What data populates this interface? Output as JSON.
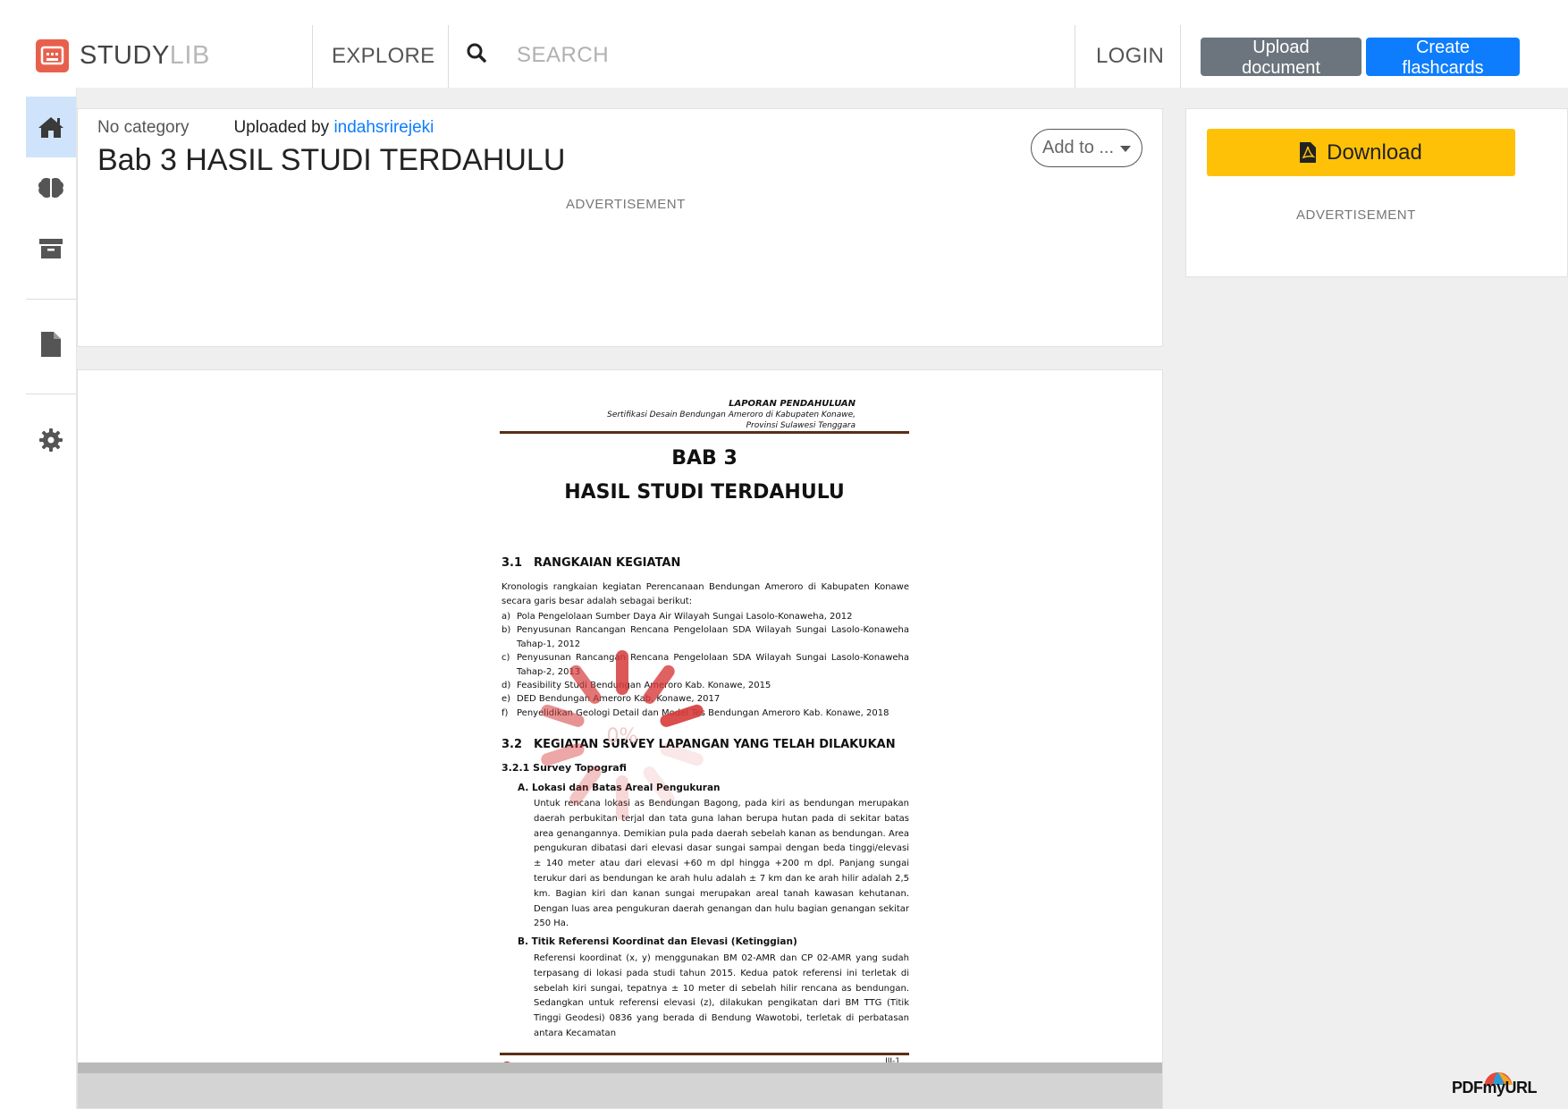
{
  "header": {
    "logo": {
      "prefix": "STUDY",
      "suffix": "LIB"
    },
    "explore_label": "EXPLORE",
    "search_placeholder": "SEARCH",
    "login_label": "LOGIN",
    "upload_label": "Upload document",
    "flashcards_label": "Create flashcards"
  },
  "sidebar": {
    "items": [
      {
        "icon": "home-icon",
        "active": true
      },
      {
        "icon": "brain-icon",
        "active": false
      },
      {
        "icon": "archive-icon",
        "active": false
      },
      {
        "icon": "document-icon",
        "active": false
      },
      {
        "icon": "gear-icon",
        "active": false
      }
    ]
  },
  "document": {
    "category": "No category",
    "uploaded_by_label": "Uploaded by",
    "uploader": "indahsrirejeki",
    "title": "Bab 3 HASIL STUDI TERDAHULU",
    "add_to_label": "Add to ...",
    "advertisement_label": "ADVERTISEMENT"
  },
  "right_panel": {
    "download_label": "Download",
    "advertisement_label": "ADVERTISEMENT"
  },
  "viewer": {
    "report_title": "LAPORAN PENDAHULUAN",
    "report_subtitle_1": "Sertifikasi Desain Bendungan Ameroro di Kabupaten Konawe,",
    "report_subtitle_2": "Provinsi Sulawesi Tenggara",
    "chapter": "BAB 3",
    "chapter_title": "HASIL STUDI TERDAHULU",
    "section_1": {
      "num": "3.1",
      "title": "RANGKAIAN KEGIATAN"
    },
    "intro": "Kronologis rangkaian kegiatan Perencanaan Bendungan Ameroro di Kabupaten Konawe secara garis besar adalah sebagai berikut:",
    "list": [
      {
        "letter": "a)",
        "text": "Pola Pengelolaan Sumber Daya Air Wilayah Sungai Lasolo-Konaweha, 2012"
      },
      {
        "letter": "b)",
        "text": "Penyusunan Rancangan Rencana Pengelolaan SDA Wilayah Sungai Lasolo-Konaweha Tahap-1, 2012"
      },
      {
        "letter": "c)",
        "text": "Penyusunan Rancangan Rencana Pengelolaan SDA Wilayah Sungai Lasolo-Konaweha Tahap-2, 2013"
      },
      {
        "letter": "d)",
        "text": "Feasibility Studi Bendungan Ameroro Kab. Konawe, 2015"
      },
      {
        "letter": "e)",
        "text": "DED Bendungan Ameroro Kab. Konawe, 2017"
      },
      {
        "letter": "f)",
        "text": "Penyelidikan Geologi Detail dan Model Tes Bendungan Ameroro Kab. Konawe, 2018"
      }
    ],
    "section_2": {
      "num": "3.2",
      "title": "KEGIATAN SURVEY LAPANGAN YANG TELAH DILAKUKAN"
    },
    "subsection": "3.2.1 Survey Topografi",
    "sub_a": "A. Lokasi dan Batas Areal Pengukuran",
    "para_a": "Untuk rencana lokasi as Bendungan Bagong, pada kiri as bendungan merupakan daerah perbukitan terjal dan tata guna lahan berupa hutan pada di sekitar batas area genangannya. Demikian pula pada daerah sebelah kanan as bendungan. Area pengukuran dibatasi dari elevasi dasar sungai sampai dengan beda tinggi/elevasi ± 140 meter atau dari elevasi +60 m dpl hingga +200 m dpl. Panjang sungai terukur dari as bendungan ke arah hulu adalah ± 7 km dan ke arah hilir adalah 2,5 km. Bagian kiri dan kanan sungai merupakan areal tanah kawasan kehutanan. Dengan luas area pengukuran daerah genangan dan hulu bagian genangan sekitar 250 Ha.",
    "sub_b": "B. Titik Referensi Koordinat dan Elevasi (Ketinggian)",
    "para_b": "Referensi koordinat (x, y) menggunakan BM 02-AMR dan CP 02-AMR yang sudah terpasang di lokasi pada studi tahun 2015. Kedua patok referensi ini terletak di sebelah kiri sungai, tepatnya ± 10 meter di sebelah hilir rencana as bendungan. Sedangkan untuk referensi elevasi (z), dilakukan pengikatan dari BM TTG (Titik Tinggi Geodesi) 0836 yang berada di Bendung Wawotobi, terletak di perbatasan antara Kecamatan",
    "page_number": "III-1",
    "spinner_text": "0%"
  },
  "watermark": "PDFmyURL",
  "colors": {
    "accent_blue": "#0d7dfd",
    "upload_gray": "#6c757d",
    "download_yellow": "#ffc107",
    "logo_red": "#e8604c",
    "spinner_red": "#d63b3b"
  }
}
